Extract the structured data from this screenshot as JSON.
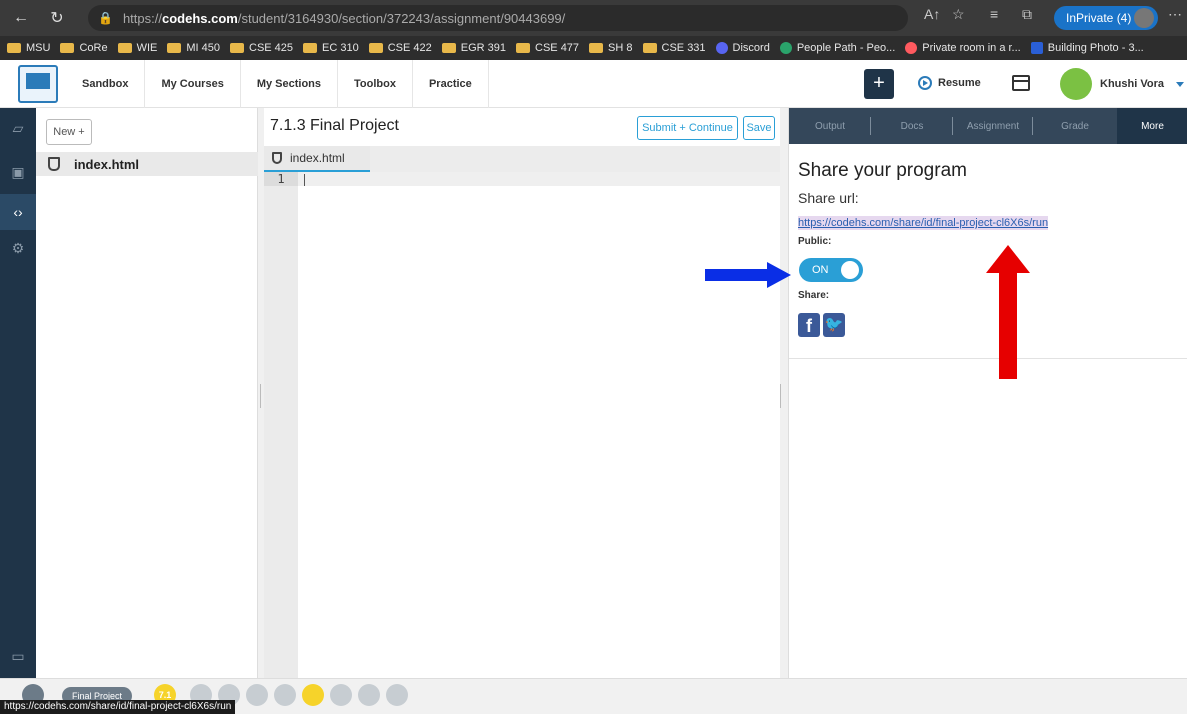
{
  "browser": {
    "url_prefix": "https://",
    "url_host": "codehs.com",
    "url_path": "/student/3164930/section/372243/assignment/90443699/",
    "inprivate": "InPrivate (4)",
    "status_url": "https://codehs.com/share/id/final-project-cl6X6s/run"
  },
  "bookmarks": [
    "MSU",
    "CoRe",
    "WIE",
    "MI 450",
    "CSE 425",
    "EC 310",
    "CSE 422",
    "EGR 391",
    "CSE 477",
    "SH 8",
    "CSE 331",
    "Discord",
    "People Path - Peo...",
    "Private room in a r...",
    "Building Photo - 3..."
  ],
  "nav": {
    "links": [
      "Sandbox",
      "My Courses",
      "My Sections",
      "Toolbox",
      "Practice"
    ],
    "plus": "+",
    "resume": "Resume",
    "user": "Khushi Vora"
  },
  "files": {
    "new_button": "New +",
    "items": [
      "index.html"
    ]
  },
  "editor": {
    "title": "7.1.3 Final Project",
    "submit": "Submit + Continue",
    "save": "Save",
    "tab": "index.html",
    "line": "1"
  },
  "panel": {
    "tabs": [
      "Output",
      "Docs",
      "Assignment",
      "Grade",
      "More"
    ],
    "heading": "Share your program",
    "share_url_label": "Share url:",
    "share_link": "https://codehs.com/share/id/final-project-cl6X6s/run",
    "public_label": "Public:",
    "toggle": "ON",
    "share_label": "Share:",
    "facebook": "f",
    "twitter": "t"
  },
  "bottom": {
    "pill": "Final Project",
    "badge": "7.1"
  },
  "colors": {
    "navy": "#1f3448",
    "accent": "#2a9fd6",
    "arrow_blue": "#0a2ee6",
    "arrow_red": "#e60000"
  }
}
